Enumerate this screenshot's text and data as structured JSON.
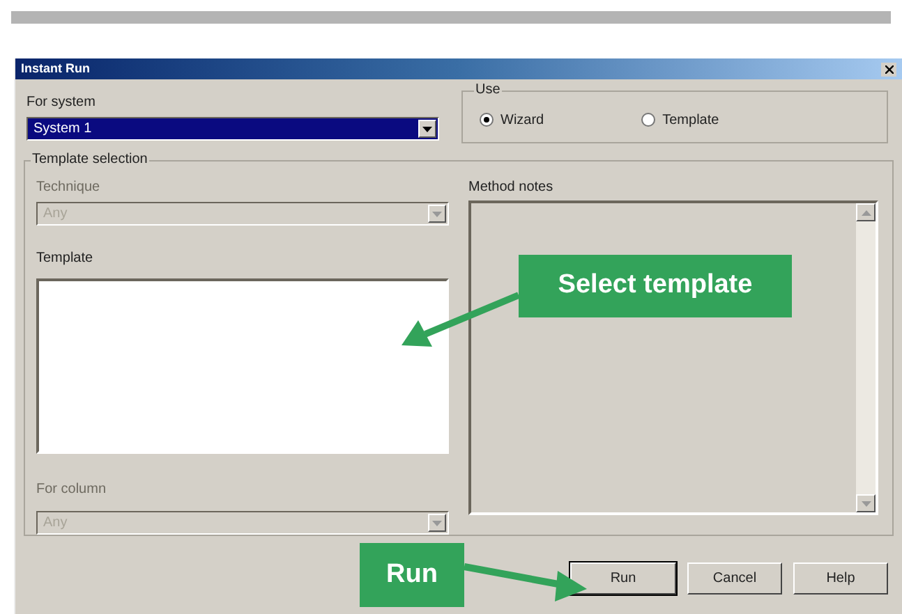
{
  "window": {
    "title": "Instant Run"
  },
  "for_system": {
    "label": "For system",
    "value": "System 1"
  },
  "use": {
    "label": "Use",
    "options": [
      {
        "label": "Wizard",
        "selected": true
      },
      {
        "label": "Template",
        "selected": false
      }
    ]
  },
  "template_selection": {
    "title": "Template selection",
    "technique": {
      "label": "Technique",
      "value": "Any",
      "disabled": true
    },
    "template": {
      "label": "Template"
    },
    "for_column": {
      "label": "For column",
      "value": "Any",
      "disabled": true
    },
    "method_notes": {
      "label": "Method notes"
    }
  },
  "buttons": [
    {
      "label": "Run"
    },
    {
      "label": "Cancel"
    },
    {
      "label": "Help"
    }
  ],
  "callouts": [
    {
      "text": "Select template"
    },
    {
      "text": "Run"
    }
  ]
}
